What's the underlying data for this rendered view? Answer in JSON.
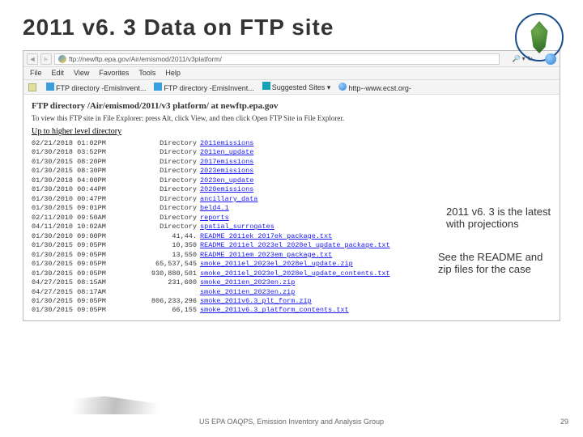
{
  "title": "2011 v6. 3 Data on FTP site",
  "browser": {
    "url": "ftp://newftp.epa.gov/Air/emismod/2011/v3platform/",
    "search_hint": "🔎 ▾ ↻",
    "menu": [
      "File",
      "Edit",
      "View",
      "Favorites",
      "Tools",
      "Help"
    ],
    "favs": {
      "a": "FTP directory -EmisInvent...",
      "b": "FTP directory -EmisInvent...",
      "c": "Suggested Sites ▾",
      "d": "http--www.ecst.org-"
    }
  },
  "page": {
    "heading": "FTP directory /Air/emismod/2011/v3 platform/ at newftp.epa.gov",
    "instr": "To view this FTP site in File Explorer: press Alt, click View, and then click Open FTP Site in File Explorer.",
    "up": "Up to higher level directory"
  },
  "rows": [
    {
      "dt": "02/21/2018 01:02PM",
      "sz": "Directory",
      "nm": "2011emissions"
    },
    {
      "dt": "01/30/2018 03:52PM",
      "sz": "Directory",
      "nm": "2011en_update"
    },
    {
      "dt": "01/30/2015 08:20PM",
      "sz": "Directory",
      "nm": "2017emissions"
    },
    {
      "dt": "01/30/2015 08:30PM",
      "sz": "Directory",
      "nm": "2023emissions"
    },
    {
      "dt": "01/30/2018 04:00PM",
      "sz": "Directory",
      "nm": "2023en_update"
    },
    {
      "dt": "01/30/2010 00:44PM",
      "sz": "Directory",
      "nm": "2020emissions"
    },
    {
      "dt": "01/30/2010 00:47PM",
      "sz": "Directory",
      "nm": "ancillary_data"
    },
    {
      "dt": "01/30/2015 09:01PM",
      "sz": "Directory",
      "nm": "beld4.1"
    },
    {
      "dt": "02/11/2010 09:50AM",
      "sz": "Directory",
      "nm": "reports"
    },
    {
      "dt": "04/11/2010 10:02AM",
      "sz": "Directory",
      "nm": "spatial_surrogates"
    },
    {
      "dt": "01/30/2010 09:00PM",
      "sz": "41,44.",
      "nm": "README 2011ek 2017ek package.txt"
    },
    {
      "dt": "01/30/2015 09:05PM",
      "sz": "10,350",
      "nm": "README 2011el 2023el 2028el update package.txt"
    },
    {
      "dt": "01/30/2015 09:05PM",
      "sz": "13,550",
      "nm": "README 2011em 2023em package.txt"
    },
    {
      "dt": "01/30/2015 09:05PM",
      "sz": "65,537,545",
      "nm": "smoke_2011el_2023el_2028el_update.zip"
    },
    {
      "dt": "01/30/2015 09:05PM",
      "sz": "930,880,501",
      "nm": "smoke_2011el_2023el_2028el_update_contents.txt"
    },
    {
      "dt": "04/27/2015 08:15AM",
      "sz": "231,600",
      "nm": "smoke_2011en_2023en.zip"
    },
    {
      "dt": "04/27/2015 08:17AM",
      "sz": "",
      "nm": "smoke_2011en_2023en.zip"
    },
    {
      "dt": "01/30/2015 09:05PM",
      "sz": "806,233,296",
      "nm": "smoke_2011v6.3_plt_form.zip"
    },
    {
      "dt": "01/30/2015 09:05PM",
      "sz": "66,155",
      "nm": "smoke_2011v6.3_platform_contents.txt"
    }
  ],
  "note1": "2011 v6. 3 is the latest with projections",
  "note2": "See the README and zip files for the case",
  "footer": "US EPA OAQPS, Emission Inventory and Analysis Group",
  "pagenum": "29"
}
